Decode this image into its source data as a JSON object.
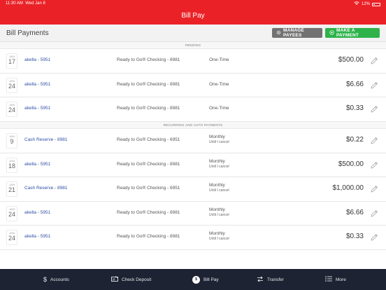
{
  "status_bar": {
    "time": "11:30 AM",
    "date": "Wed Jan 8",
    "battery": "12%"
  },
  "nav": {
    "title": "Bill Pay"
  },
  "header": {
    "title": "Bill Payments",
    "manage_payees_label": "MANAGE PAYEES",
    "make_payment_label": "MAKE A PAYMENT"
  },
  "sections": {
    "pending": "PENDING",
    "recurring": "RECURRING AND AUTO PAYMENTS"
  },
  "pending": [
    {
      "month": "JAN",
      "day": "17",
      "payee": "akella - 5951",
      "account": "Ready to Go® Checking - 8981",
      "frequency": "One-Time",
      "until": "",
      "amount": "$500.00"
    },
    {
      "month": "JAN",
      "day": "24",
      "payee": "akella - 5951",
      "account": "Ready to Go® Checking - 8981",
      "frequency": "One-Time",
      "until": "",
      "amount": "$6.66"
    },
    {
      "month": "JAN",
      "day": "24",
      "payee": "akella - 5951",
      "account": "Ready to Go® Checking - 8981",
      "frequency": "One-Time",
      "until": "",
      "amount": "$0.33"
    }
  ],
  "recurring": [
    {
      "month": "JAN",
      "day": "9",
      "payee": "Cash Reserve - 8981",
      "account": "Ready to Go® Checking - 6951",
      "frequency": "Monthly",
      "until": "Until I cancel",
      "amount": "$0.22"
    },
    {
      "month": "JAN",
      "day": "18",
      "payee": "akella - 5951",
      "account": "Ready to Go® Checking - 8981",
      "frequency": "Monthly",
      "until": "Until I cancel",
      "amount": "$500.00"
    },
    {
      "month": "JAN",
      "day": "21",
      "payee": "Cash Reserve - 8981",
      "account": "Ready to Go® Checking - 6951",
      "frequency": "Monthly",
      "until": "Until I cancel",
      "amount": "$1,000.00"
    },
    {
      "month": "JAN",
      "day": "24",
      "payee": "akella - 5951",
      "account": "Ready to Go® Checking - 8981",
      "frequency": "Monthly",
      "until": "Until I cancel",
      "amount": "$6.66"
    },
    {
      "month": "JAN",
      "day": "24",
      "payee": "akella - 5951",
      "account": "Ready to Go® Checking - 8981",
      "frequency": "Monthly",
      "until": "Until I cancel",
      "amount": "$0.33"
    }
  ],
  "tabs": {
    "accounts": "Accounts",
    "check_deposit": "Check Deposit",
    "bill_pay": "Bill Pay",
    "transfer": "Transfer",
    "more": "More"
  },
  "colors": {
    "brand_red": "#ea2227",
    "green": "#2db34a",
    "tabbar": "#1d2333",
    "link_blue": "#2f4fa6"
  },
  "icons": [
    "wifi-icon",
    "battery-icon",
    "gear-icon",
    "plus-circle-icon",
    "pencil-icon",
    "dollar-icon",
    "check-deposit-icon",
    "bill-pay-icon",
    "transfer-icon",
    "more-icon"
  ]
}
